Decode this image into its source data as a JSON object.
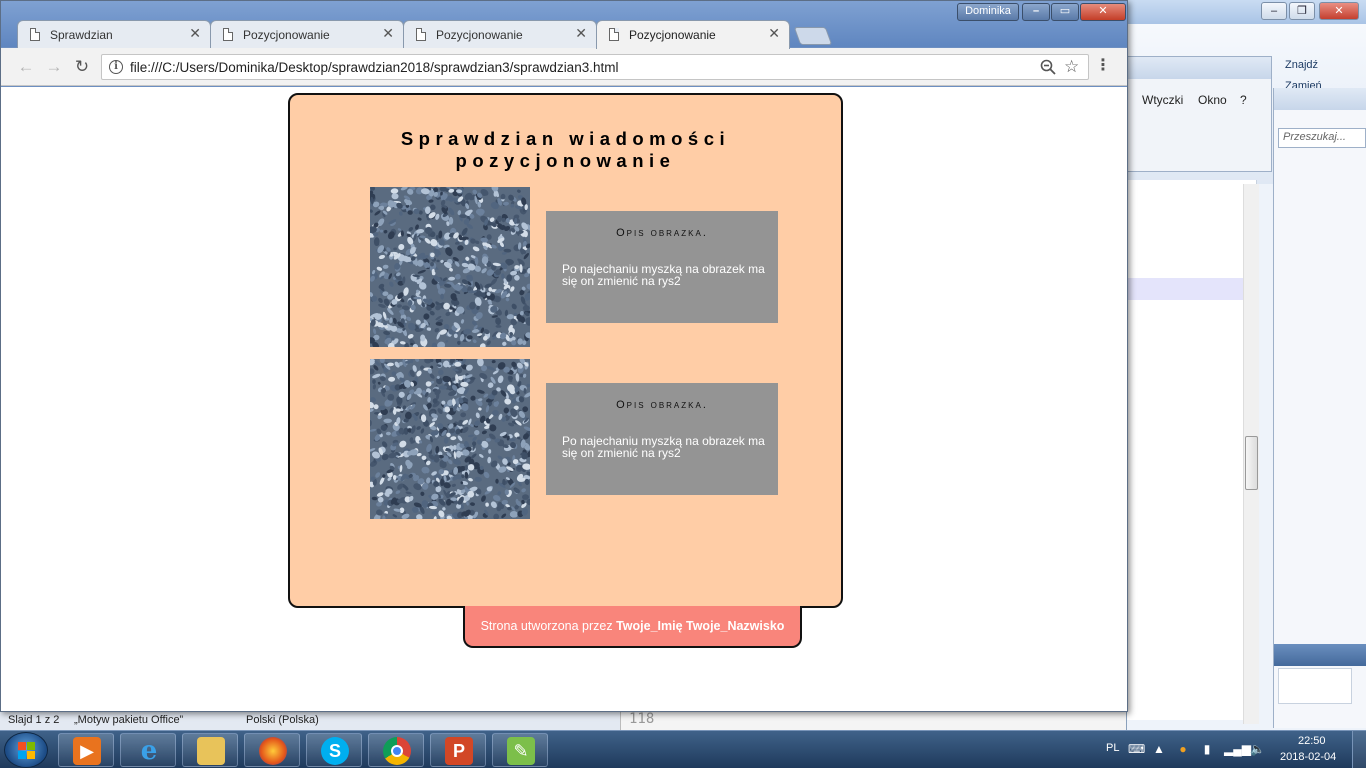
{
  "browser": {
    "user_badge": "Dominika",
    "tabs": [
      {
        "label": "Sprawdzian"
      },
      {
        "label": "Pozycjonowanie"
      },
      {
        "label": "Pozycjonowanie"
      },
      {
        "label": "Pozycjonowanie"
      }
    ],
    "active_tab_index": 3,
    "url": "file:///C:/Users/Dominika/Desktop/sprawdzian2018/sprawdzian3/sprawdzian3.html"
  },
  "page": {
    "title_line1": "Sprawdzian wiadomości",
    "title_line2": "pozycjonowanie",
    "items": [
      {
        "heading": "Opis obrazka.",
        "text": "Po najechaniu myszką na obrazek ma się on zmienić na rys2"
      },
      {
        "heading": "Opis obrazka.",
        "text": "Po najechaniu myszką na obrazek ma się on zmienić na rys2"
      }
    ],
    "footer_prefix": "Strona utworzona przez ",
    "footer_author": "Twoje_Imię Twoje_Nazwisko"
  },
  "background_apps": {
    "find_label": "Znajdź",
    "replace_label": "Zamień",
    "menu_plugins": "Wtyczki",
    "menu_window": "Okno",
    "menu_help": "?",
    "search_placeholder": "Przeszukaj...",
    "status_slide": "Slajd 1 z 2",
    "status_theme": "„Motyw pakietu Office”",
    "status_language": "Polski (Polska)",
    "editor_line": "118"
  },
  "taskbar": {
    "apps": [
      "windows-media-player",
      "internet-explorer",
      "file-explorer",
      "firefox",
      "skype",
      "chrome",
      "powerpoint",
      "editor"
    ],
    "language": "PL",
    "time": "22:50",
    "date": "2018-02-04"
  },
  "colors": {
    "card_background": "#ffcda6",
    "description_background": "#949494",
    "footer_background": "#f9857b"
  }
}
